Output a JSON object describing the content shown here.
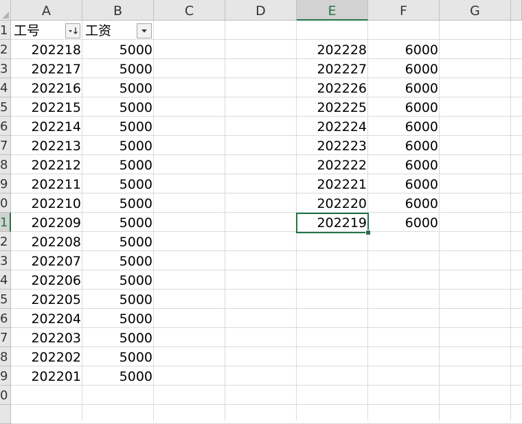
{
  "columns": [
    "A",
    "B",
    "C",
    "D",
    "E",
    "F",
    "G"
  ],
  "rows": [
    "1",
    "2",
    "3",
    "4",
    "5",
    "6",
    "7",
    "8",
    "9",
    "0",
    "1",
    "2",
    "3",
    "4",
    "5",
    "6",
    "7",
    "8",
    "9",
    "0",
    ""
  ],
  "selected_column": "E",
  "selected_row_label": "1",
  "header": {
    "a": "工号",
    "b": "工资"
  },
  "col_a_values": [
    "202218",
    "202217",
    "202216",
    "202215",
    "202214",
    "202213",
    "202212",
    "202211",
    "202210",
    "202209",
    "202208",
    "202207",
    "202206",
    "202205",
    "202204",
    "202203",
    "202202",
    "202201"
  ],
  "col_b_values": [
    "5000",
    "5000",
    "5000",
    "5000",
    "5000",
    "5000",
    "5000",
    "5000",
    "5000",
    "5000",
    "5000",
    "5000",
    "5000",
    "5000",
    "5000",
    "5000",
    "5000",
    "5000"
  ],
  "col_e_values": [
    "202228",
    "202227",
    "202226",
    "202225",
    "202224",
    "202223",
    "202222",
    "202221",
    "202220",
    "202219"
  ],
  "col_f_values": [
    "6000",
    "6000",
    "6000",
    "6000",
    "6000",
    "6000",
    "6000",
    "6000",
    "6000",
    "6000"
  ],
  "filter_icons": {
    "a": "sort-descending-filter-icon",
    "b": "filter-dropdown-icon"
  },
  "colors": {
    "accent": "#217346",
    "header_bg": "#e6e6e6",
    "gridline": "#dadada"
  }
}
